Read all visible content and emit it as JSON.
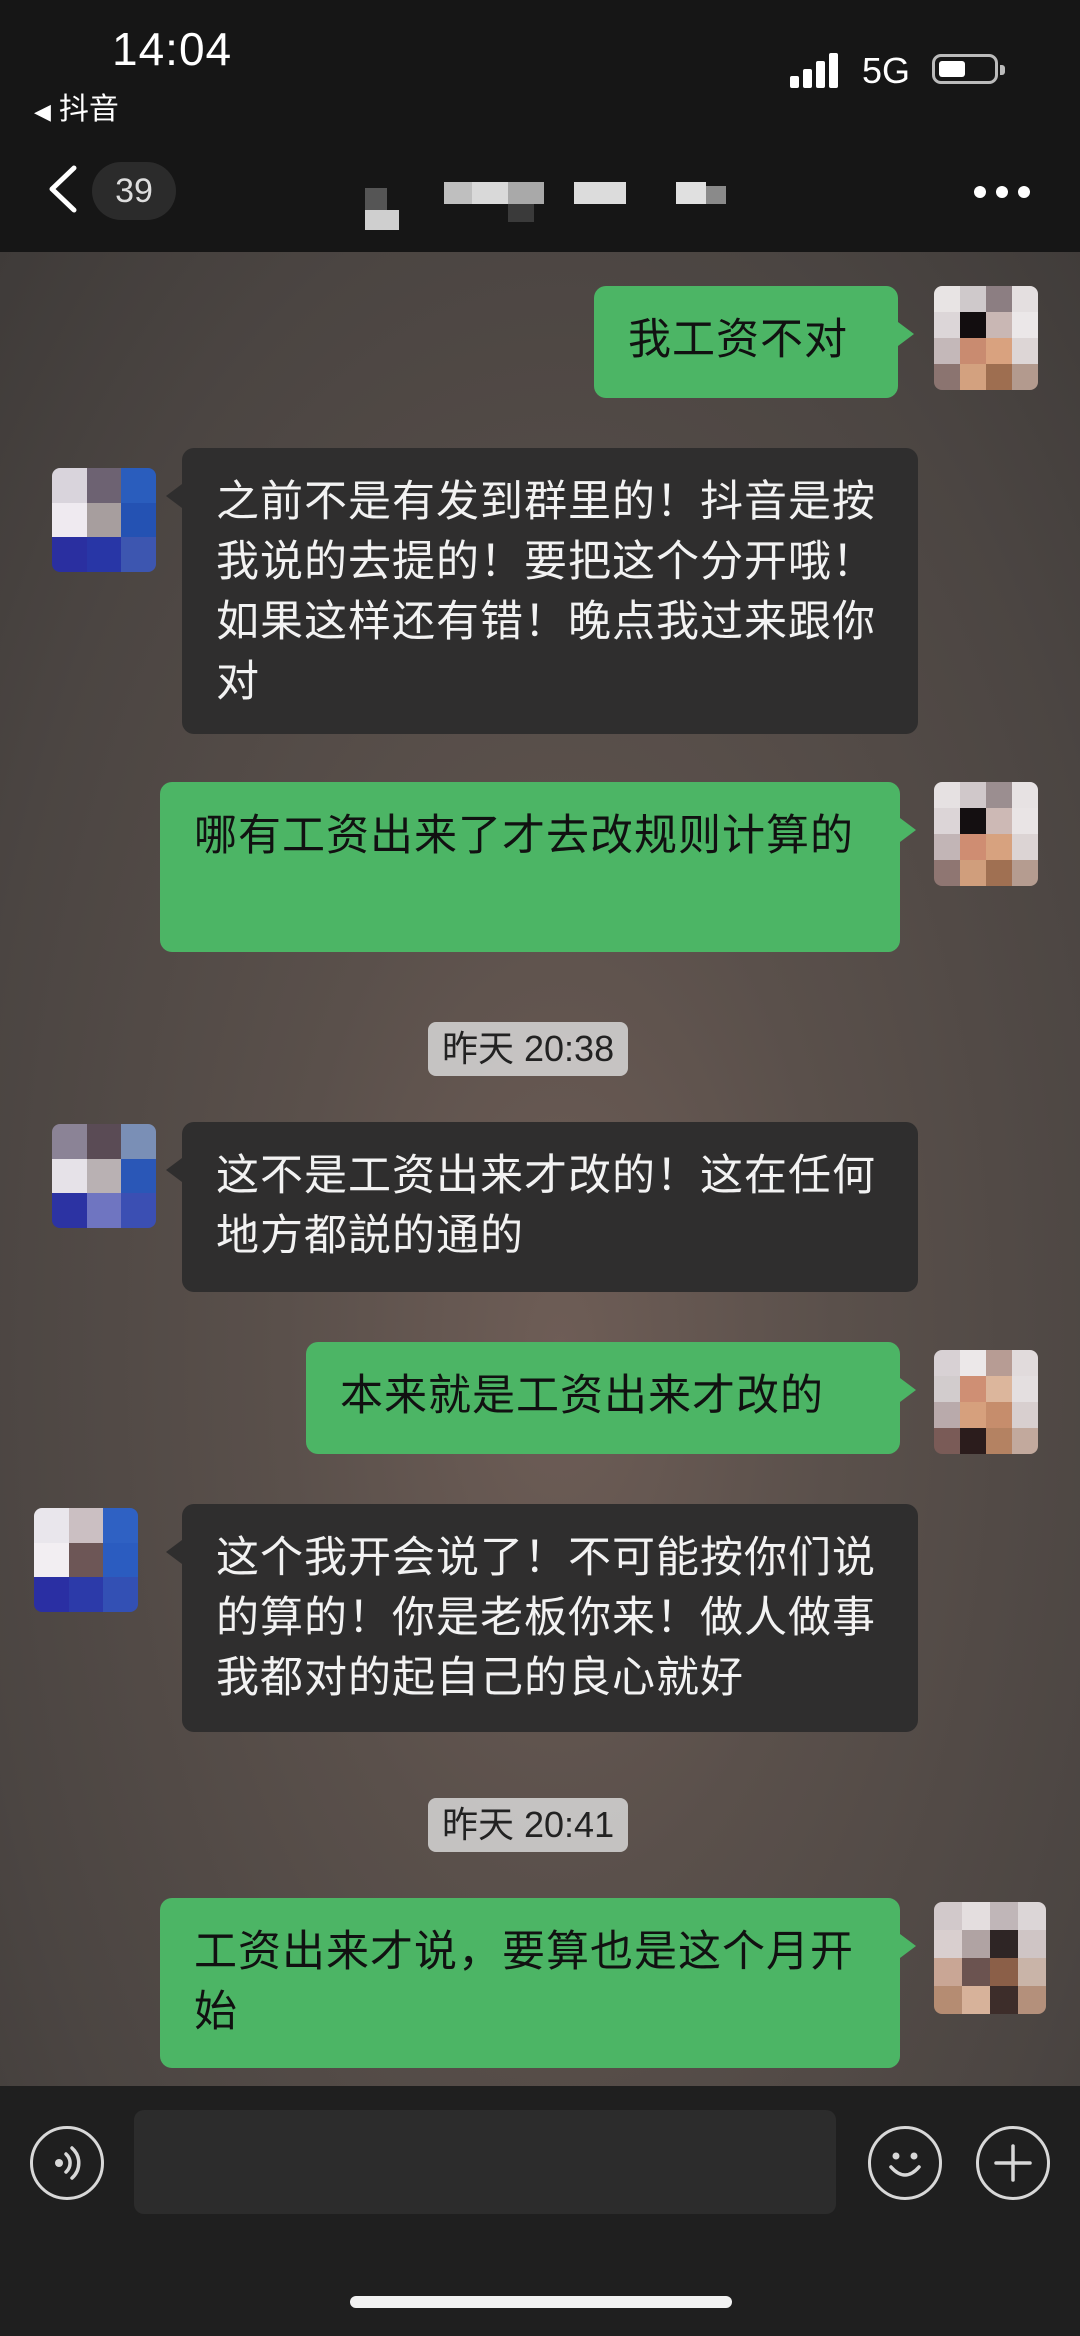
{
  "status_bar": {
    "time": "14:04",
    "back_app": "抖音",
    "network": "5G"
  },
  "nav": {
    "unread_count": "39",
    "more_icon": "more-dots-icon",
    "back_icon": "chevron-left-icon"
  },
  "messages": [
    {
      "side": "out",
      "text": "我工资不对"
    },
    {
      "side": "in",
      "text": "之前不是有发到群里的！抖音是按我说的去提的！要把这个分开哦！如果这样还有错！晚点我过来跟你对"
    },
    {
      "side": "out",
      "text": "哪有工资出来了才去改规则计算的"
    },
    {
      "type": "timestamp",
      "text": "昨天 20:38"
    },
    {
      "side": "in",
      "text": "这不是工资出来才改的！这在任何地方都説的通的"
    },
    {
      "side": "out",
      "text": "本来就是工资出来才改的"
    },
    {
      "side": "in",
      "text": "这个我开会说了！不可能按你们说的算的！你是老板你来！做人做事我都对的起自己的良心就好"
    },
    {
      "type": "timestamp",
      "text": "昨天 20:41"
    },
    {
      "side": "out",
      "text": "工资出来才说，要算也是这个月开始"
    }
  ],
  "input_bar": {
    "voice_icon": "voice-icon",
    "emoji_icon": "emoji-icon",
    "plus_icon": "plus-icon",
    "text_value": ""
  },
  "colors": {
    "outgoing_bubble": "#4cb565",
    "incoming_bubble": "#2f2e2e",
    "bar_background": "#161616"
  }
}
